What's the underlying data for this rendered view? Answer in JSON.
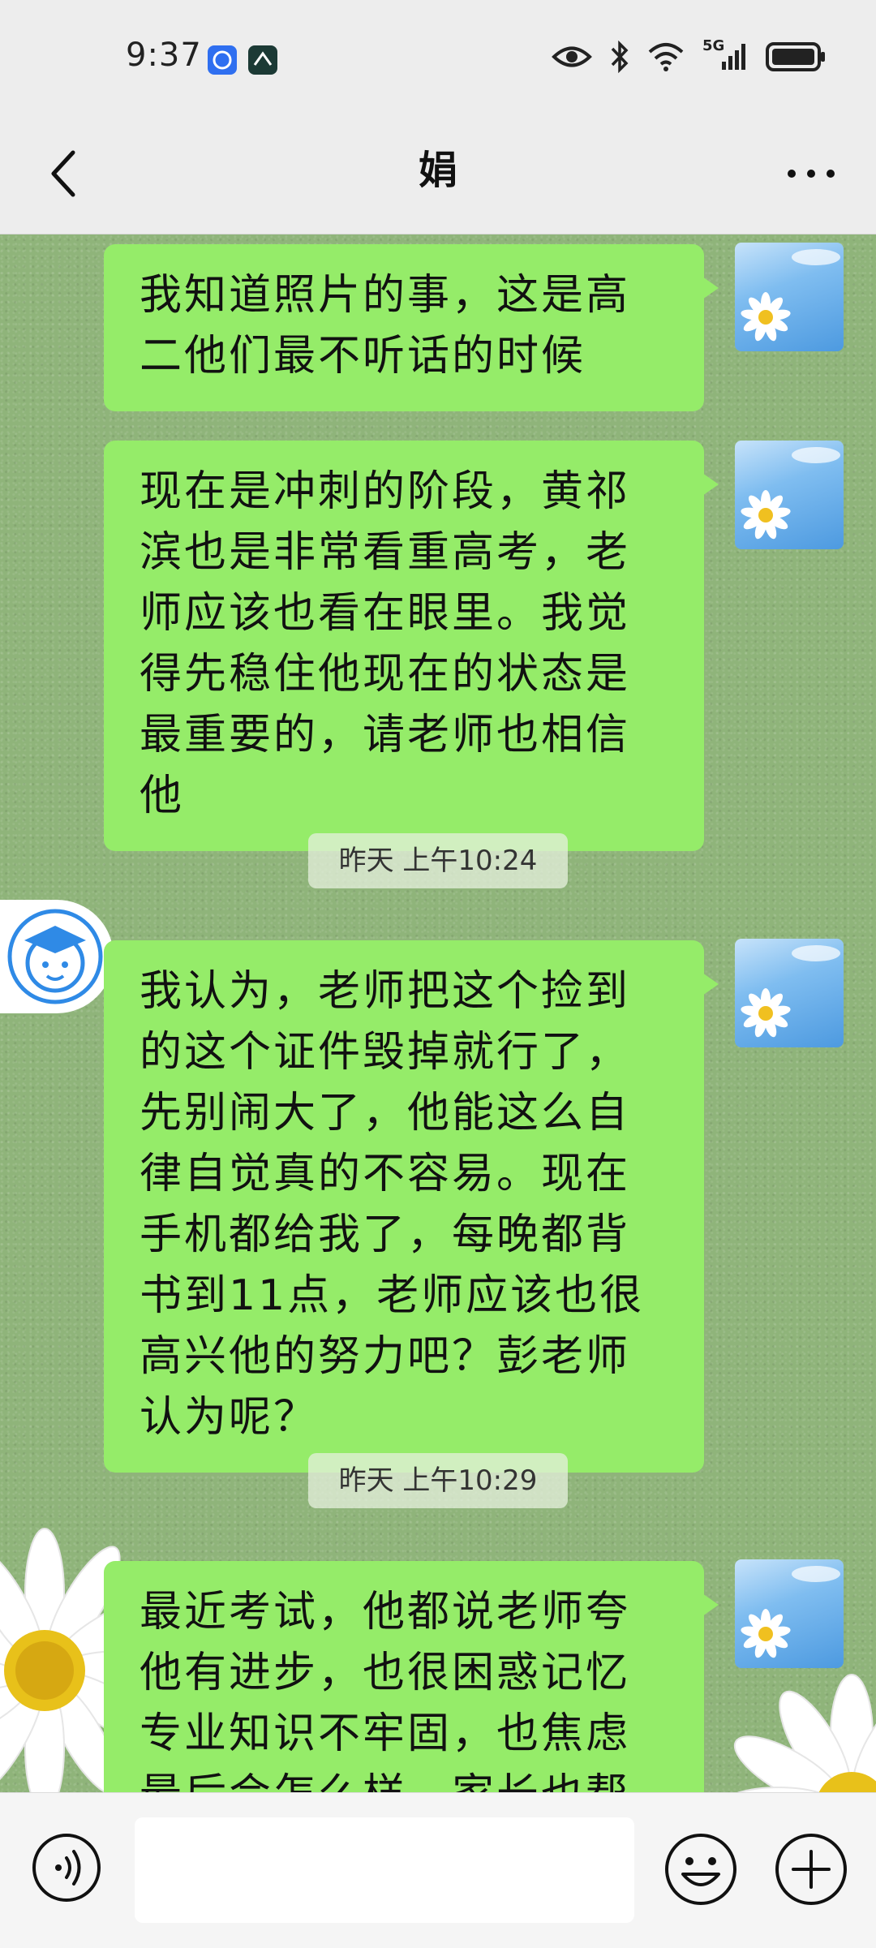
{
  "status_bar": {
    "time": "9:37",
    "network_label": "5G"
  },
  "header": {
    "title": "娟"
  },
  "messages": [
    {
      "text": "我知道照片的事，这是高二他们最不听话的时候"
    },
    {
      "text": "现在是冲刺的阶段，黄祁滨也是非常看重高考，老师应该也看在眼里。我觉得先稳住他现在的状态是最重要的，请老师也相信他"
    },
    {
      "timestamp": "昨天 上午10:24"
    },
    {
      "text": "我认为，老师把这个捡到的这个证件毁掉就行了，先别闹大了，他能这么自律自觉真的不容易。现在手机都给我了，每晚都背书到11点，老师应该也很高兴他的努力吧？彭老师认为呢？"
    },
    {
      "timestamp": "昨天 上午10:29"
    },
    {
      "text": "最近考试，他都说老师夸他有进步，也很困惑记忆专业知识不牢固，也焦虑最后会怎么样…家长也帮不了他什"
    }
  ],
  "input": {
    "value": "",
    "placeholder": ""
  },
  "colors": {
    "bubble": "#95ec69",
    "chat_background": "#8fb47a",
    "bar_background": "#ededed"
  },
  "icons": [
    "back-icon",
    "more-icon",
    "voice-icon",
    "emoji-icon",
    "plus-icon",
    "eye-icon",
    "bluetooth-icon",
    "wifi-icon",
    "signal-icon",
    "battery-icon"
  ]
}
